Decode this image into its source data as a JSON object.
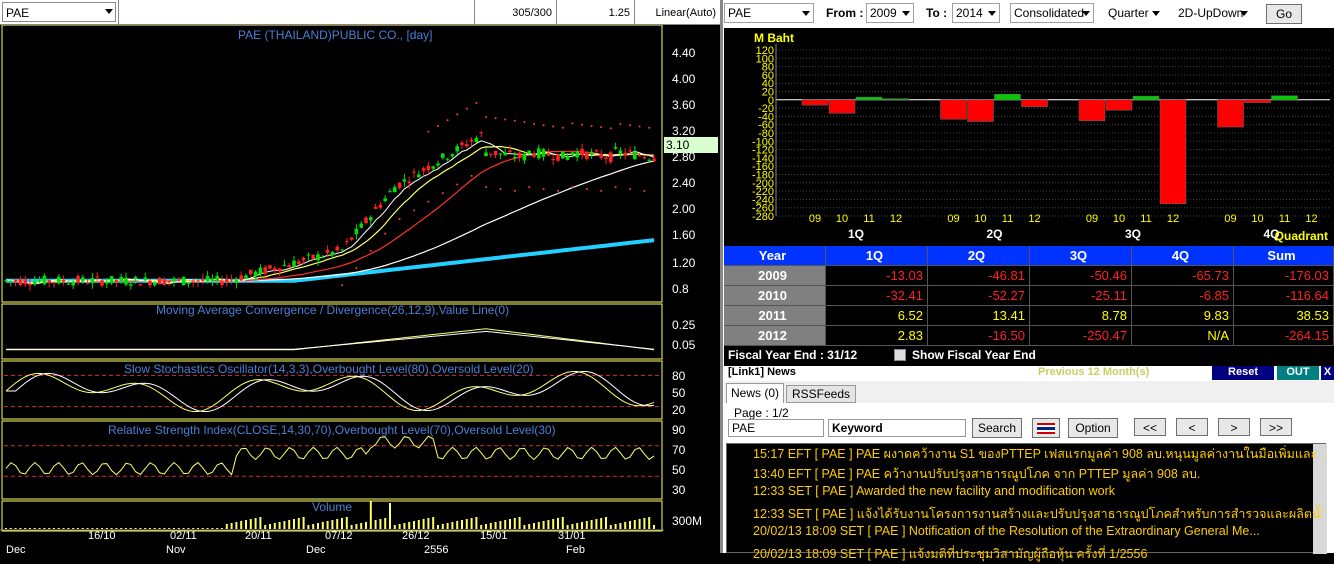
{
  "chart_window": {
    "symbol": "PAE",
    "bars_count": "305/300",
    "zoom": "1.25",
    "scale_mode": "Linear(Auto)",
    "price_panel_title": "PAE (THAILAND)PUBLIC CO., [day]",
    "price_axis": [
      "4.40",
      "4.00",
      "3.60",
      "3.20",
      "2.80",
      "2.40",
      "2.00",
      "1.60",
      "1.20",
      "0.8"
    ],
    "last_price": "3.10",
    "macd_title": "Moving Average Convergence / Divergence(26,12,9),Value Line(0)",
    "macd_axis": [
      "0.25",
      "0.05"
    ],
    "stoch_title": "Slow Stochastics Oscillator(14,3,3),Overbought Level(80),Oversold Level(20)",
    "stoch_axis": [
      "80",
      "50",
      "20"
    ],
    "rsi_title": "Relative Strength Index(CLOSE,14,30,70),Overbought Level(70),Oversold Level(30)",
    "rsi_axis": [
      "90",
      "70",
      "50",
      "30"
    ],
    "volume_title": "Volume",
    "volume_axis": "300M",
    "date_axis": [
      "16/10",
      "02/11",
      "20/11",
      "07/12",
      "26/12",
      "15/01",
      "31/01"
    ],
    "month_axis": [
      "Dec",
      "Nov",
      "Dec",
      "2556",
      "Feb"
    ],
    "colors": {
      "up": "#00e000",
      "down": "#ff2020",
      "ma_fast": "#ffff66",
      "ma_mid": "#ff3030",
      "ma_slow": "#ffffff",
      "ma_long": "#22d0ff",
      "panel_title": "#4a7fd6"
    }
  },
  "financial": {
    "symbol": "PAE",
    "from_label": "From :",
    "from_year": "2009",
    "to_label": "To :",
    "to_year": "2014",
    "statement": "Consolidated",
    "period": "Quarter",
    "chart_mode": "2D-UpDown",
    "go_label": "Go",
    "unit_label": "M Baht",
    "quadrant_label": "Quadrant",
    "y_axis": [
      "120",
      "100",
      "80",
      "60",
      "40",
      "20",
      "0",
      "-20",
      "-40",
      "-60",
      "-80",
      "-100",
      "-120",
      "-140",
      "-160",
      "-180",
      "-200",
      "-220",
      "-240",
      "-260",
      "-280"
    ],
    "quarters": [
      "1Q",
      "2Q",
      "3Q",
      "4Q"
    ],
    "year_ticks": [
      "09",
      "10",
      "11",
      "12"
    ],
    "table_headers": [
      "Year",
      "1Q",
      "2Q",
      "3Q",
      "4Q",
      "Sum"
    ],
    "table_rows": [
      {
        "year": "2009",
        "q1": "-13.03",
        "q2": "-46.81",
        "q3": "-50.46",
        "q4": "-65.73",
        "sum": "-176.03"
      },
      {
        "year": "2010",
        "q1": "-32.41",
        "q2": "-52.27",
        "q3": "-25.11",
        "q4": "-6.85",
        "sum": "-116.64"
      },
      {
        "year": "2011",
        "q1": "6.52",
        "q2": "13.41",
        "q3": "8.78",
        "q4": "9.83",
        "sum": "38.53"
      },
      {
        "year": "2012",
        "q1": "2.83",
        "q2": "-16.50",
        "q3": "-250.47",
        "q4": "N/A",
        "sum": "-264.15"
      }
    ],
    "fiscal_label": "Fiscal  Year  End  :  31/12",
    "show_fiscal_label": "Show Fiscal Year End"
  },
  "chart_data": {
    "type": "bar",
    "title": "",
    "ylabel": "M Baht",
    "xlabel": "Quadrant",
    "ylim": [
      -280,
      120
    ],
    "categories": [
      "1Q",
      "2Q",
      "3Q",
      "4Q"
    ],
    "series": [
      {
        "name": "09",
        "values": [
          -13.03,
          -46.81,
          -50.46,
          -65.73
        ]
      },
      {
        "name": "10",
        "values": [
          -32.41,
          -52.27,
          -25.11,
          -6.85
        ]
      },
      {
        "name": "11",
        "values": [
          6.52,
          13.41,
          8.78,
          9.83
        ]
      },
      {
        "name": "12",
        "values": [
          2.83,
          -16.5,
          -250.47,
          null
        ]
      }
    ]
  },
  "news": {
    "header_label": "[Link1] News",
    "period_label": "Previous 12 Month(s)",
    "reset_label": "Reset",
    "out_label": "OUT",
    "close_label": "X",
    "tabs": [
      "News (0)",
      "RSSFeeds"
    ],
    "page_label": "Page : 1/2",
    "symbol_value": "PAE",
    "keyword_placeholder": "Keyword",
    "search_label": "Search",
    "option_label": "Option",
    "nav": [
      "<<",
      "<",
      ">",
      ">>"
    ],
    "items": [
      "15:17  EFT  [ PAE ]  PAE ผงาดคว้างาน S1 ของPTTEP เฟสแรกมูลค่า 908 ลบ.หนุนมูลค่างานในมือเพิ่มและ ...",
      "13:40  EFT  [ PAE ]  PAE คว้างานปรับปรุงสาธารณูปโภค จาก PTTEP มูลค่า 908 ลบ.",
      "12:33  SET  [ PAE ]  Awarded  the new facility and modification work",
      "12:33  SET  [ PAE ]  แจ้งได้รับงานโครงการงานสร้างและปรับปรุงสาธารณูปโภคสำหรับการสำรวจและผลิตน้ำมัน...",
      "20/02/13 18:09  SET  [ PAE ]  Notification of the Resolution of the Extraordinary General Me...",
      "20/02/13 18:09  SET  [ PAE ]  แจ้งมติที่ประชุมวิสามัญผู้ถือหุ้น ครั้งที่ 1/2556"
    ]
  }
}
